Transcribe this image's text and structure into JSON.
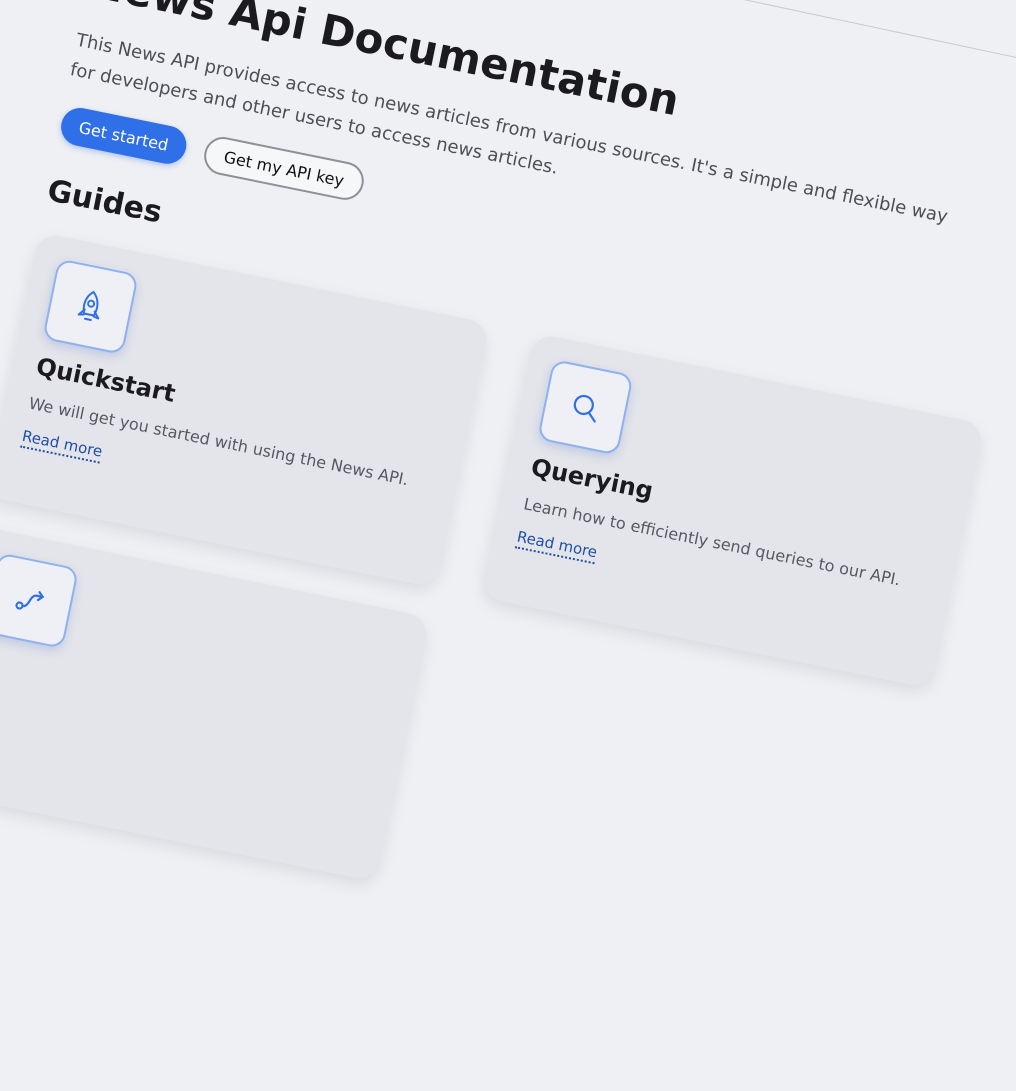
{
  "header": {
    "title": "News Api Documentation",
    "description": "This News API provides access to news articles from various sources. It's a simple and flexible way for developers and other users to access news articles."
  },
  "actions": {
    "get_started_label": "Get started",
    "get_api_key_label": "Get my API key"
  },
  "guides": {
    "heading": "Guides",
    "cards": [
      {
        "icon": "rocket-icon",
        "title": "Quickstart",
        "description": "We will get you started with using the News API.",
        "link": "Read more"
      },
      {
        "icon": "search-icon",
        "title": "Querying",
        "description": "Learn how to efficiently send queries to our API.",
        "link": "Read more"
      },
      {
        "icon": "route-icon",
        "title": "",
        "description": "",
        "link": ""
      }
    ]
  },
  "colors": {
    "accent": "#2f6fe8",
    "background": "#eff0f3",
    "card": "#e4e5ea",
    "link": "#1f4da8"
  }
}
